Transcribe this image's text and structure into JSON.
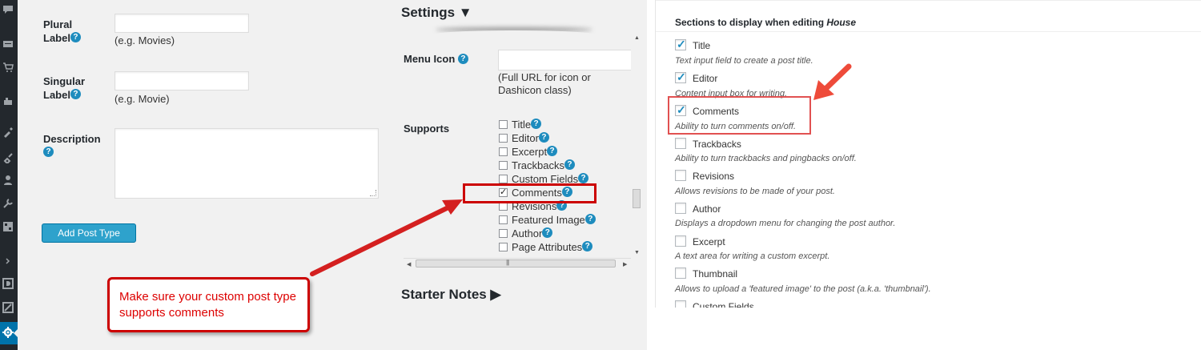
{
  "admin_sidebar": {
    "icons": [
      "comments-icon",
      "feedback-icon",
      "cart-icon",
      "products-icon",
      "appearance-icon",
      "plugins-icon",
      "users-icon",
      "tools-icon",
      "grid-icon",
      "collapse-icon",
      "media-icon",
      "image-icon",
      "settings-icon"
    ]
  },
  "post_type_form": {
    "plural_label": {
      "label_line1": "Plural",
      "label_line2": "Label",
      "help": "?",
      "value": "",
      "hint": "(e.g. Movies)"
    },
    "singular_label": {
      "label_line1": "Singular",
      "label_line2": "Label",
      "help": "?",
      "value": "",
      "hint": "(e.g. Movie)"
    },
    "description": {
      "label": "Description",
      "help": "?",
      "value": ""
    },
    "add_button": "Add Post Type"
  },
  "settings": {
    "heading": "Settings ▼",
    "menu_icon": {
      "label": "Menu Icon",
      "help": "?",
      "value": "",
      "hint": "(Full URL for icon or Dashicon class)"
    },
    "supports_label": "Supports",
    "supports": [
      {
        "label": "Title",
        "checked": false
      },
      {
        "label": "Editor",
        "checked": false
      },
      {
        "label": "Excerpt",
        "checked": false
      },
      {
        "label": "Trackbacks",
        "checked": false
      },
      {
        "label": "Custom Fields",
        "checked": false
      },
      {
        "label": "Comments",
        "checked": true
      },
      {
        "label": "Revisions",
        "checked": false
      },
      {
        "label": "Featured Image",
        "checked": false
      },
      {
        "label": "Author",
        "checked": false
      },
      {
        "label": "Page Attributes",
        "checked": false
      }
    ],
    "help_glyph": "?",
    "scroll_grip": "|||"
  },
  "starter_notes": "Starter Notes ▶",
  "annotation": {
    "callout_text": "Make sure your custom post type supports comments",
    "accent_color": "#cc0000"
  },
  "sections_panel": {
    "title_prefix": "Sections to display when editing ",
    "title_post_type": "House",
    "options": [
      {
        "label": "Title",
        "checked": true,
        "desc": "Text input field to create a post title."
      },
      {
        "label": "Editor",
        "checked": true,
        "desc": "Content input box for writing."
      },
      {
        "label": "Comments",
        "checked": true,
        "desc": "Ability to turn comments on/off."
      },
      {
        "label": "Trackbacks",
        "checked": false,
        "desc": "Ability to turn trackbacks and pingbacks on/off."
      },
      {
        "label": "Revisions",
        "checked": false,
        "desc": "Allows revisions to be made of your post."
      },
      {
        "label": "Author",
        "checked": false,
        "desc": "Displays a dropdown menu for changing the post author."
      },
      {
        "label": "Excerpt",
        "checked": false,
        "desc": "A text area for writing a custom excerpt."
      },
      {
        "label": "Thumbnail",
        "checked": false,
        "desc": "Allows to upload a 'featured image' to the post (a.k.a. 'thumbnail')."
      },
      {
        "label": "Custom Fields",
        "checked": false,
        "desc": ""
      }
    ]
  }
}
